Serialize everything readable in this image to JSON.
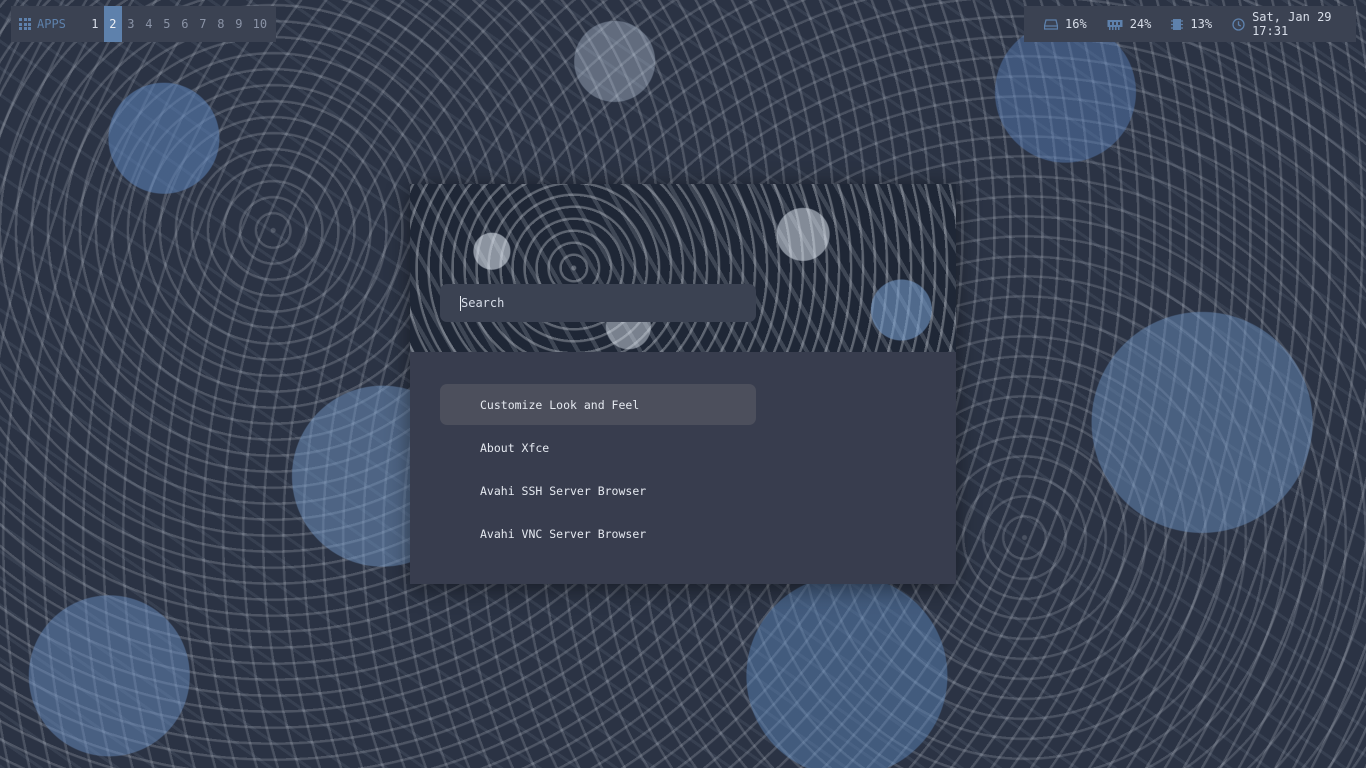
{
  "top_left_bar": {
    "apps_label": "APPS",
    "workspaces": [
      "1",
      "2",
      "3",
      "4",
      "5",
      "6",
      "7",
      "8",
      "9",
      "10"
    ],
    "active_workspace": "2"
  },
  "top_right_bar": {
    "disk": {
      "icon": "disk-icon",
      "value": "16%"
    },
    "memory": {
      "icon": "memory-icon",
      "value": "24%"
    },
    "cpu": {
      "icon": "cpu-icon",
      "value": "13%"
    },
    "clock": {
      "icon": "clock-icon",
      "value": "Sat, Jan 29 17:31"
    }
  },
  "launcher": {
    "search_placeholder": "Search",
    "results": [
      {
        "label": "Customize Look and Feel",
        "selected": true
      },
      {
        "label": "About Xfce",
        "selected": false
      },
      {
        "label": "Avahi SSH Server Browser",
        "selected": false
      },
      {
        "label": "Avahi VNC Server Browser",
        "selected": false
      }
    ]
  },
  "colors": {
    "bar_bg": "#3b4252",
    "accent": "#5e81ac",
    "launcher_bg": "#383d4e",
    "selected_bg": "#4c4f5c",
    "text": "#d8dee9"
  }
}
